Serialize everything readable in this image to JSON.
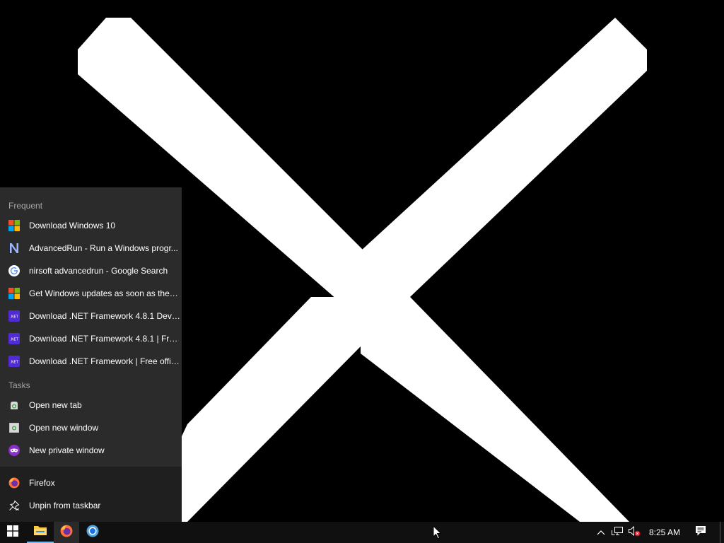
{
  "jumplist": {
    "frequent_header": "Frequent",
    "frequent_items": [
      {
        "label": "Download Windows 10",
        "icon": "microsoft-logo-icon"
      },
      {
        "label": "AdvancedRun - Run a Windows progr...",
        "icon": "nirsoft-n-icon"
      },
      {
        "label": "nirsoft advancedrun - Google Search",
        "icon": "google-g-icon"
      },
      {
        "label": "Get Windows updates as soon as they'...",
        "icon": "microsoft-logo-icon"
      },
      {
        "label": "Download .NET Framework 4.8.1 Devel...",
        "icon": "dotnet-icon"
      },
      {
        "label": "Download .NET Framework 4.8.1 | Free...",
        "icon": "dotnet-icon"
      },
      {
        "label": "Download .NET Framework | Free offici...",
        "icon": "dotnet-icon"
      }
    ],
    "tasks_header": "Tasks",
    "task_items": [
      {
        "label": "Open new tab",
        "icon": "new-tab-icon"
      },
      {
        "label": "Open new window",
        "icon": "new-window-icon"
      },
      {
        "label": "New private window",
        "icon": "private-window-icon"
      }
    ],
    "footer_items": [
      {
        "label": "Firefox",
        "icon": "firefox-icon"
      },
      {
        "label": "Unpin from taskbar",
        "icon": "unpin-icon"
      }
    ]
  },
  "taskbar": {
    "buttons": [
      {
        "name": "start-button",
        "icon": "windows-logo-icon"
      },
      {
        "name": "file-explorer-button",
        "icon": "folder-icon"
      },
      {
        "name": "firefox-button",
        "icon": "firefox-icon"
      },
      {
        "name": "chrome-button",
        "icon": "chrome-icon"
      }
    ],
    "tray": {
      "time": "8:25 AM",
      "icons": [
        "chevron-up-icon",
        "network-icon",
        "volume-muted-icon",
        "notifications-icon"
      ]
    }
  },
  "colors": {
    "jumplist_bg": "#2b2b2b",
    "jumplist_footer_bg": "#1f1f1f",
    "taskbar_bg": "#101010",
    "section_header": "#a6a6a6",
    "accent_blue": "#4cc2ff",
    "dotnet_purple": "#512bd4"
  }
}
